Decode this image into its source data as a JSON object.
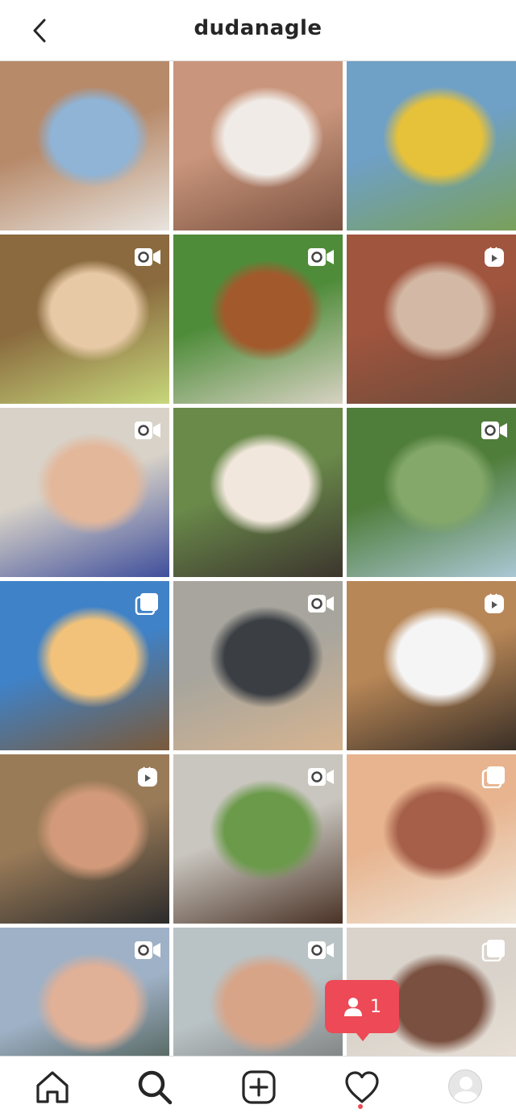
{
  "header": {
    "title": "dudanagle",
    "back_icon": "chevron-left-icon"
  },
  "posts": [
    {
      "type": "photo",
      "colors": [
        "#b78a6a",
        "#8fb4d6",
        "#e8e4de"
      ]
    },
    {
      "type": "photo",
      "colors": [
        "#c9957c",
        "#f0ebe6",
        "#7b5240"
      ]
    },
    {
      "type": "photo",
      "colors": [
        "#6fa0c6",
        "#e6c13a",
        "#79a05a"
      ]
    },
    {
      "type": "video",
      "colors": [
        "#8a6a3e",
        "#e7c9a6",
        "#c7d77b"
      ]
    },
    {
      "type": "video",
      "colors": [
        "#4f8c3a",
        "#a25a2d",
        "#d7d2c2"
      ]
    },
    {
      "type": "reel",
      "colors": [
        "#a0553e",
        "#d3b9a5",
        "#6b4b3a"
      ]
    },
    {
      "type": "video",
      "colors": [
        "#d8d2c8",
        "#e3b79a",
        "#3f4f9c"
      ]
    },
    {
      "type": "photo",
      "colors": [
        "#6a8a4a",
        "#f1e7dc",
        "#3c352e"
      ]
    },
    {
      "type": "video",
      "colors": [
        "#4f7d3a",
        "#84a86a",
        "#aac7d4"
      ]
    },
    {
      "type": "carousel",
      "colors": [
        "#3f82c8",
        "#f2c27a",
        "#7a5a3a"
      ]
    },
    {
      "type": "video",
      "colors": [
        "#a7a59d",
        "#3b3f44",
        "#d6b490"
      ]
    },
    {
      "type": "reel",
      "colors": [
        "#b88757",
        "#f5f5f5",
        "#3a2f26"
      ]
    },
    {
      "type": "reel",
      "colors": [
        "#9a7b58",
        "#d29a7a",
        "#2b2b2b"
      ]
    },
    {
      "type": "video",
      "colors": [
        "#c9c6bf",
        "#6b9a4a",
        "#4a3226"
      ]
    },
    {
      "type": "carousel",
      "colors": [
        "#e7b48f",
        "#a6604a",
        "#f0e6d8"
      ]
    },
    {
      "type": "video",
      "colors": [
        "#9fb1c6",
        "#e0b097",
        "#3a4a3a"
      ]
    },
    {
      "type": "video",
      "colors": [
        "#b9c2c4",
        "#d8a488",
        "#6a6a6a"
      ]
    },
    {
      "type": "carousel",
      "colors": [
        "#d9d3cb",
        "#7a5040",
        "#efe6dc"
      ]
    },
    {
      "type": "photo",
      "colors": [
        "#d89a5a",
        "#f1ede6",
        "#5c4434"
      ]
    },
    {
      "type": "photo",
      "colors": [
        "#8f9aa3",
        "#cfd6da",
        "#a7a7a7"
      ]
    },
    {
      "type": "photo",
      "colors": [
        "#3a4a5a",
        "#6b7b4b",
        "#a6b5c0"
      ]
    }
  ],
  "notification": {
    "icon": "person-icon",
    "count": "1",
    "color": "#ed4956"
  },
  "tabs": [
    {
      "name": "home",
      "icon": "home-icon"
    },
    {
      "name": "search",
      "icon": "search-icon"
    },
    {
      "name": "new-post",
      "icon": "plus-square-icon"
    },
    {
      "name": "activity",
      "icon": "heart-icon"
    },
    {
      "name": "profile",
      "icon": "avatar-icon"
    }
  ]
}
